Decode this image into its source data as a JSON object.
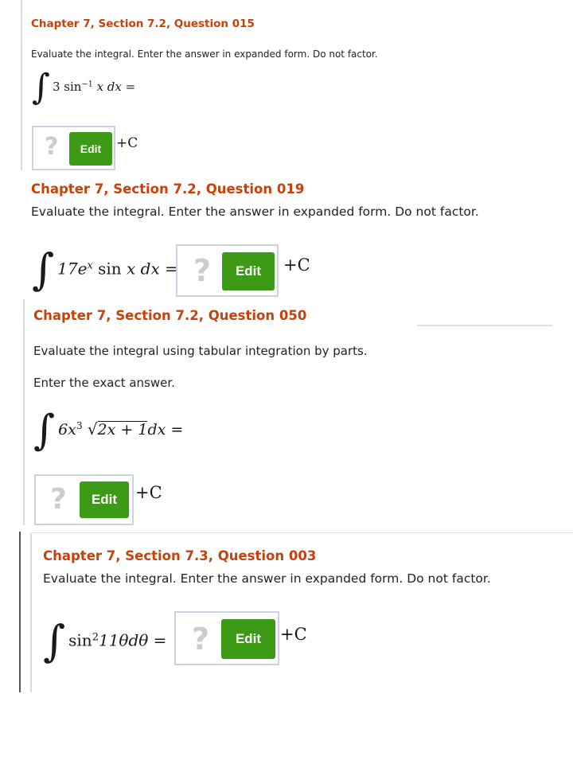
{
  "questions": [
    {
      "title": "Chapter 7, Section 7.2, Question 015",
      "instruction": "Evaluate the integral. Enter the answer in expanded form. Do not factor.",
      "integrand_coef": "3 sin",
      "integrand_exp": "−1",
      "integrand_var": "x",
      "integrand_d": " dx =",
      "answer_placeholder": "?",
      "edit_label": "Edit",
      "constant": "+C"
    },
    {
      "title": "Chapter 7, Section 7.2, Question 019",
      "instruction": "Evaluate the integral. Enter the answer in expanded form. Do not factor.",
      "integrand_coef": "17e",
      "integrand_exp": "x",
      "integrand_rest": " sin ",
      "integrand_var": "x",
      "integrand_d": " dx =",
      "answer_placeholder": "?",
      "edit_label": "Edit",
      "constant": "+C"
    },
    {
      "title": "Chapter 7, Section 7.2, Question 050",
      "instruction": "Evaluate the integral using tabular integration by parts.",
      "instruction2": "Enter the exact answer.",
      "integrand_coef": "6x",
      "integrand_exp": "3",
      "integrand_radicand": "2x + 1",
      "integrand_d": "dx =",
      "answer_placeholder": "?",
      "edit_label": "Edit",
      "constant": "+C"
    },
    {
      "title": "Chapter 7, Section 7.3, Question 003",
      "instruction": "Evaluate the integral. Enter the answer in expanded form. Do not factor.",
      "integrand_coef": "sin",
      "integrand_exp": "2",
      "integrand_rest": "11θdθ =",
      "answer_placeholder": "?",
      "edit_label": "Edit",
      "constant": "+C"
    }
  ],
  "colors": {
    "title": "#c8410b",
    "edit_button": "#3d9a16",
    "answer_box_border": "#c9d3e4",
    "placeholder": "#cccccc"
  }
}
